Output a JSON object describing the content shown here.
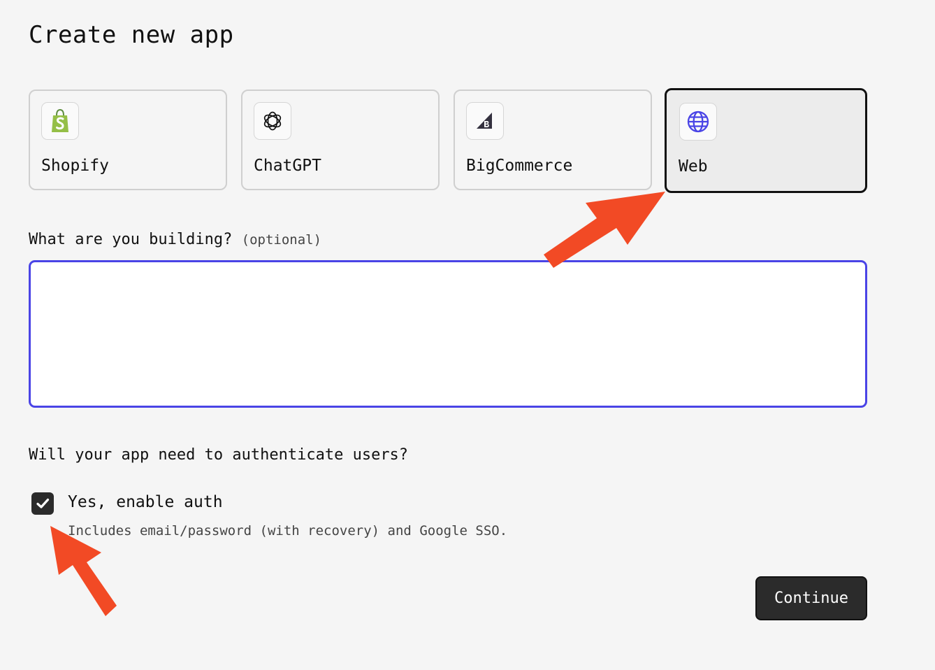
{
  "page": {
    "title": "Create new app"
  },
  "platforms": [
    {
      "label": "Shopify",
      "icon": "shopify-bag-icon",
      "selected": false
    },
    {
      "label": "ChatGPT",
      "icon": "openai-logo-icon",
      "selected": false
    },
    {
      "label": "BigCommerce",
      "icon": "bigcommerce-logo-icon",
      "selected": false
    },
    {
      "label": "Web",
      "icon": "globe-icon",
      "selected": true
    }
  ],
  "description": {
    "label": "What are you building?",
    "optional_hint": "(optional)",
    "value": ""
  },
  "auth": {
    "question": "Will your app need to authenticate users?",
    "checkbox_label": "Yes, enable auth",
    "checked": true,
    "help_text": "Includes email/password (with recovery) and Google SSO."
  },
  "actions": {
    "continue_label": "Continue"
  },
  "colors": {
    "accent": "#4a44e6",
    "annotation_arrow": "#f24a25",
    "button_bg": "#2b2b2b",
    "shopify_green": "#95bf47"
  }
}
